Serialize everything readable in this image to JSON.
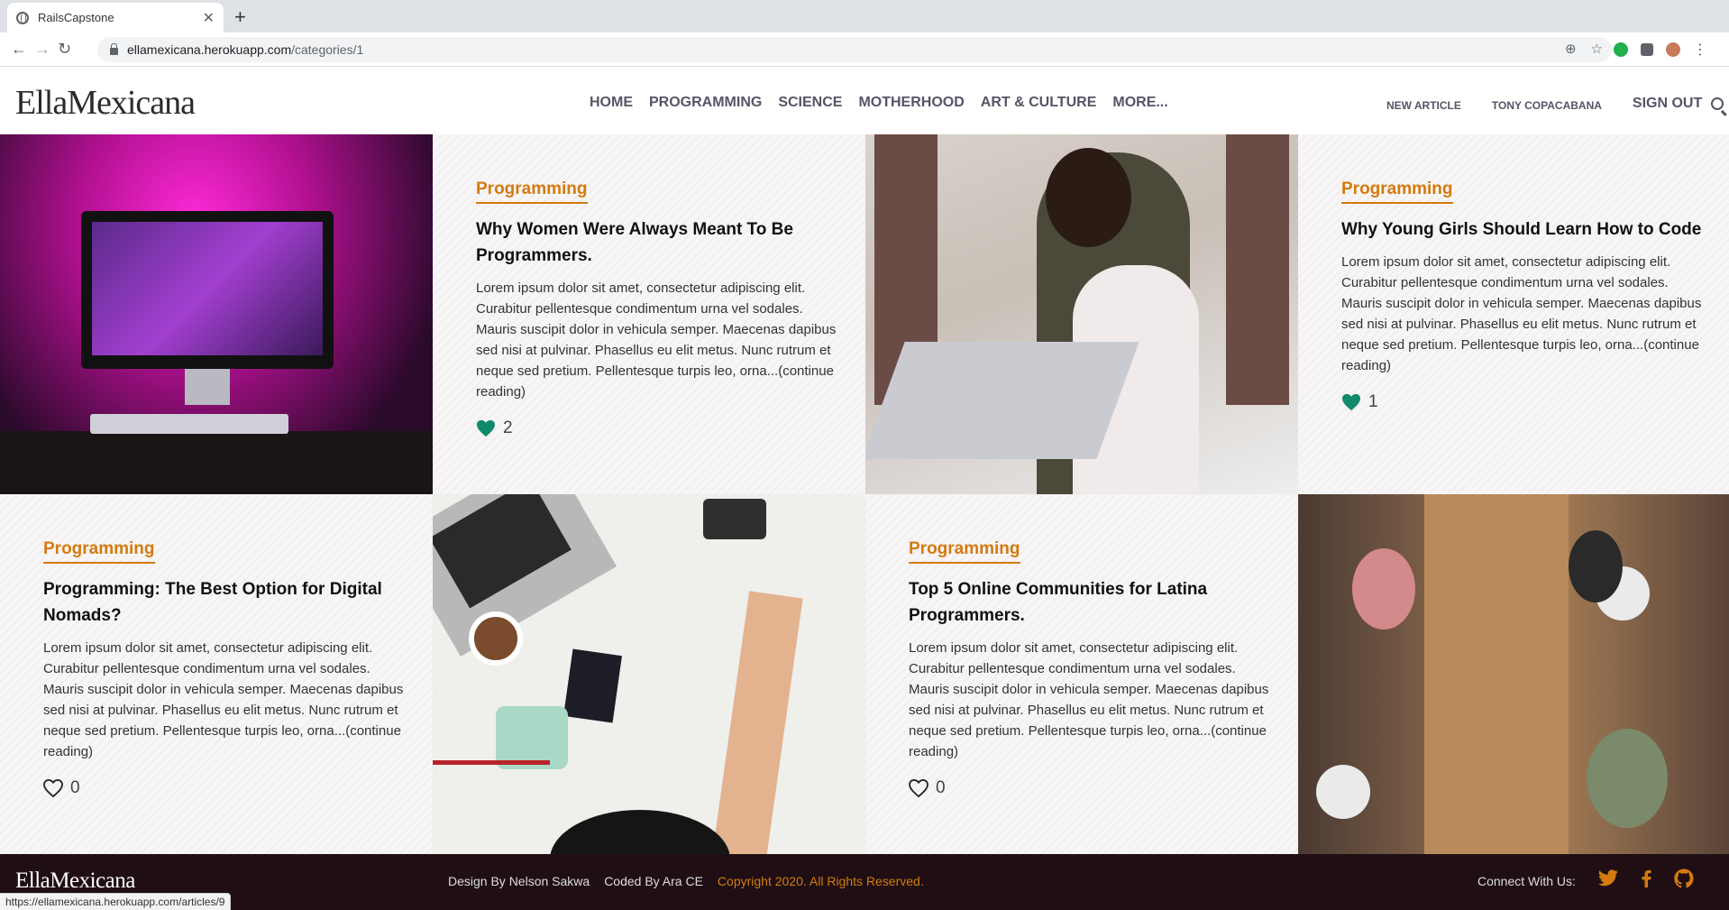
{
  "browser": {
    "tab_title": "RailsCapstone",
    "url_host": "ellamexicana.herokuapp.com",
    "url_path": "/categories/1",
    "status_url": "https://ellamexicana.herokuapp.com/articles/9"
  },
  "site": {
    "logo": "EllaMexicana",
    "nav": [
      "HOME",
      "PROGRAMMING",
      "SCIENCE",
      "MOTHERHOOD",
      "ART & CULTURE",
      "MORE..."
    ],
    "new_article": "NEW ARTICLE",
    "user_name": "TONY COPACABANA",
    "sign_out": "SIGN OUT"
  },
  "articles": [
    {
      "category": "Programming",
      "title": "Why Women Were Always Meant To Be Programmers.",
      "excerpt": "Lorem ipsum dolor sit amet, consectetur adipiscing elit. Curabitur pellentesque condimentum urna vel sodales. Mauris suscipit dolor in vehicula semper. Maecenas dapibus sed nisi at pulvinar. Phasellus eu elit metus. Nunc rutrum et neque sed pretium. Pellentesque turpis leo, orna...(continue reading)",
      "likes": "2",
      "liked": true
    },
    {
      "category": "Programming",
      "title": "Why Young Girls Should Learn How to Code",
      "excerpt": "Lorem ipsum dolor sit amet, consectetur adipiscing elit. Curabitur pellentesque condimentum urna vel sodales. Mauris suscipit dolor in vehicula semper. Maecenas dapibus sed nisi at pulvinar. Phasellus eu elit metus. Nunc rutrum et neque sed pretium. Pellentesque turpis leo, orna...(continue reading)",
      "likes": "1",
      "liked": true
    },
    {
      "category": "Programming",
      "title": "Programming: The Best Option for Digital Nomads?",
      "excerpt": "Lorem ipsum dolor sit amet, consectetur adipiscing elit. Curabitur pellentesque condimentum urna vel sodales. Mauris suscipit dolor in vehicula semper. Maecenas dapibus sed nisi at pulvinar. Phasellus eu elit metus. Nunc rutrum et neque sed pretium. Pellentesque turpis leo, orna...(continue reading)",
      "likes": "0",
      "liked": false
    },
    {
      "category": "Programming",
      "title": "Top 5 Online Communities for Latina Programmers.",
      "excerpt": "Lorem ipsum dolor sit amet, consectetur adipiscing elit. Curabitur pellentesque condimentum urna vel sodales. Mauris suscipit dolor in vehicula semper. Maecenas dapibus sed nisi at pulvinar. Phasellus eu elit metus. Nunc rutrum et neque sed pretium. Pellentesque turpis leo, orna...(continue reading)",
      "likes": "0",
      "liked": false
    }
  ],
  "footer": {
    "logo": "EllaMexicana",
    "design_by": "Design By Nelson Sakwa",
    "coded_by": "Coded By Ara CE",
    "copyright": "Copyright 2020. All Rights Reserved.",
    "connect": "Connect With Us:"
  },
  "colors": {
    "accent": "#d37b0f",
    "heart_liked": "#0f8a6a",
    "footer_bg": "#1f0f14"
  }
}
